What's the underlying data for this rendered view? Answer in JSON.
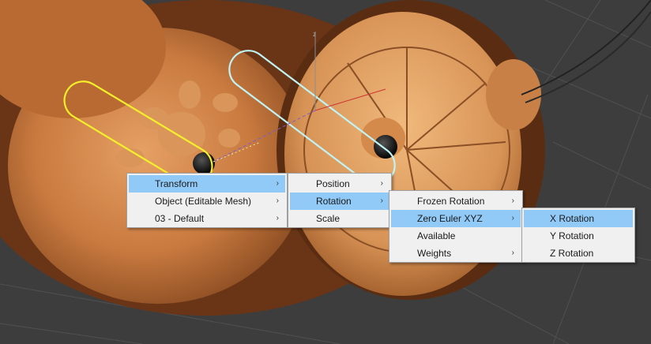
{
  "menus": {
    "level1": [
      {
        "label": "Transform",
        "submenu": true,
        "highlighted": true
      },
      {
        "label": "Object (Editable Mesh)",
        "submenu": true,
        "highlighted": false
      },
      {
        "label": "03 - Default",
        "submenu": true,
        "highlighted": false
      }
    ],
    "level2": [
      {
        "label": "Position",
        "submenu": true,
        "highlighted": false
      },
      {
        "label": "Rotation",
        "submenu": true,
        "highlighted": true
      },
      {
        "label": "Scale",
        "submenu": false,
        "highlighted": false
      }
    ],
    "level3": [
      {
        "label": "Frozen Rotation",
        "submenu": true,
        "highlighted": false
      },
      {
        "label": "Zero Euler XYZ",
        "submenu": true,
        "highlighted": true
      },
      {
        "label": "Available",
        "submenu": false,
        "highlighted": false
      },
      {
        "label": "Weights",
        "submenu": true,
        "highlighted": false
      }
    ],
    "level4": [
      {
        "label": "X Rotation",
        "submenu": false,
        "highlighted": true
      },
      {
        "label": "Y Rotation",
        "submenu": false,
        "highlighted": false
      },
      {
        "label": "Z Rotation",
        "submenu": false,
        "highlighted": false
      }
    ]
  },
  "gizmo": {
    "axis_z_label": "z"
  },
  "submenu_arrow": "›",
  "colors": {
    "highlight": "#91c9f7",
    "menu_bg": "#f0f0f0",
    "selection_yellow": "#f5f02a",
    "selection_cyan": "#bff4f6"
  }
}
